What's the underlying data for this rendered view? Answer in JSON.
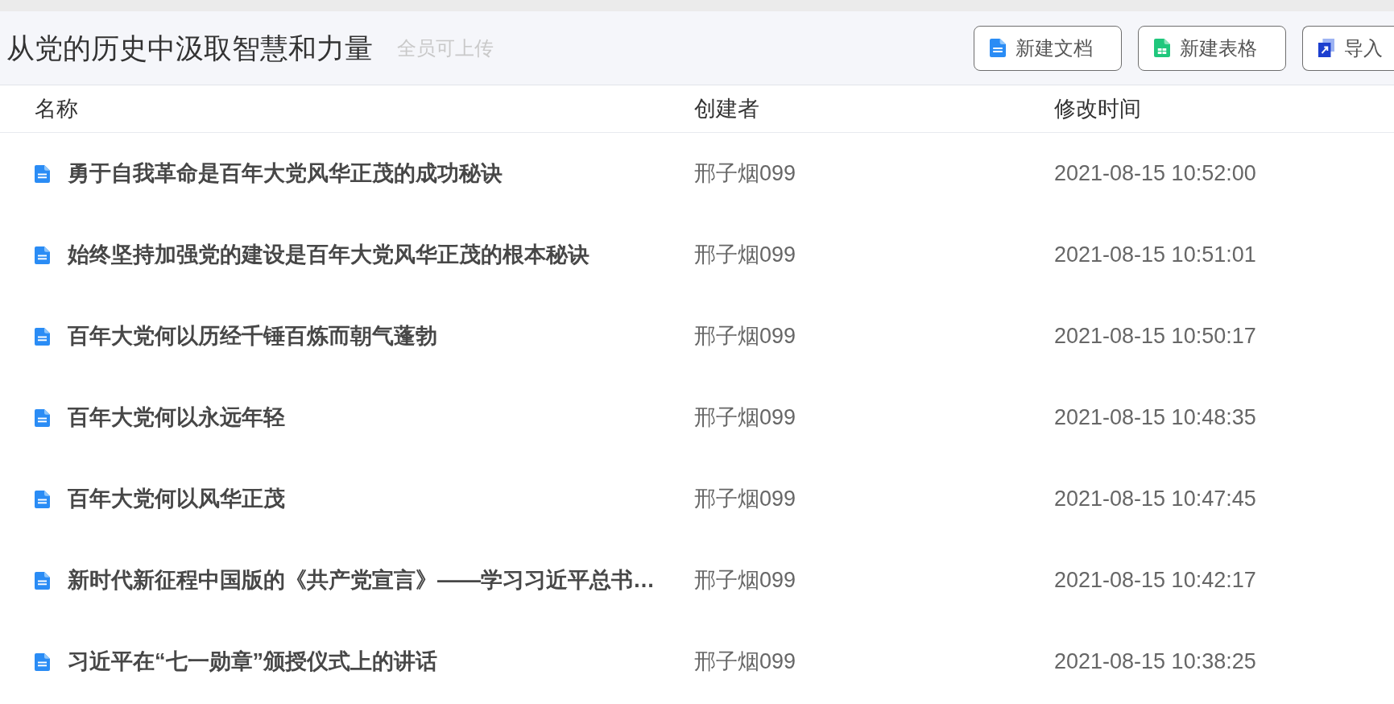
{
  "header": {
    "title": "从党的历史中汲取智慧和力量",
    "permission": "全员可上传",
    "buttons": [
      {
        "kind": "doc",
        "label": "新建文档"
      },
      {
        "kind": "sheet",
        "label": "新建表格"
      },
      {
        "kind": "import",
        "label": "导入"
      }
    ]
  },
  "table": {
    "columns": [
      "名称",
      "创建者",
      "修改时间"
    ],
    "rows": [
      {
        "name": "勇于自我革命是百年大党风华正茂的成功秘诀",
        "creator": "邢子烟099",
        "modified": "2021-08-15 10:52:00"
      },
      {
        "name": "始终坚持加强党的建设是百年大党风华正茂的根本秘诀",
        "creator": "邢子烟099",
        "modified": "2021-08-15 10:51:01"
      },
      {
        "name": "百年大党何以历经千锤百炼而朝气蓬勃",
        "creator": "邢子烟099",
        "modified": "2021-08-15 10:50:17"
      },
      {
        "name": "百年大党何以永远年轻",
        "creator": "邢子烟099",
        "modified": "2021-08-15 10:48:35"
      },
      {
        "name": "百年大党何以风华正茂",
        "creator": "邢子烟099",
        "modified": "2021-08-15 10:47:45"
      },
      {
        "name": "新时代新征程中国版的《共产党宣言》——学习习近平总书…",
        "creator": "邢子烟099",
        "modified": "2021-08-15 10:42:17"
      },
      {
        "name": "习近平在“七一勋章”颁授仪式上的讲话",
        "creator": "邢子烟099",
        "modified": "2021-08-15 10:38:25"
      }
    ]
  }
}
